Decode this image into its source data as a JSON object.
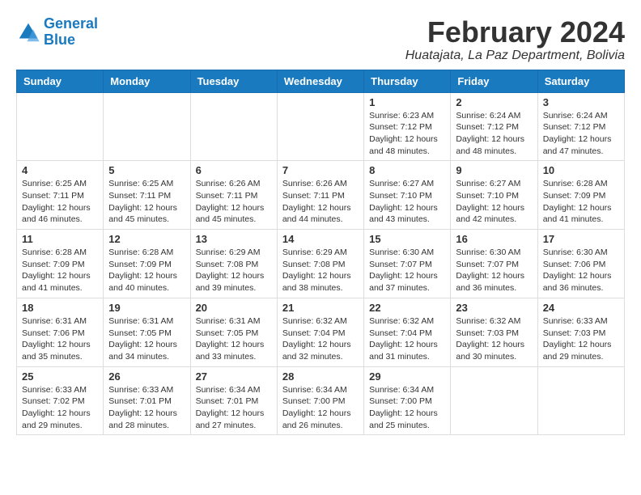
{
  "logo": {
    "line1": "General",
    "line2": "Blue"
  },
  "title": {
    "month_year": "February 2024",
    "location": "Huatajata, La Paz Department, Bolivia"
  },
  "weekdays": [
    "Sunday",
    "Monday",
    "Tuesday",
    "Wednesday",
    "Thursday",
    "Friday",
    "Saturday"
  ],
  "weeks": [
    [
      {
        "day": "",
        "sunrise": "",
        "sunset": "",
        "daylight": ""
      },
      {
        "day": "",
        "sunrise": "",
        "sunset": "",
        "daylight": ""
      },
      {
        "day": "",
        "sunrise": "",
        "sunset": "",
        "daylight": ""
      },
      {
        "day": "",
        "sunrise": "",
        "sunset": "",
        "daylight": ""
      },
      {
        "day": "1",
        "sunrise": "Sunrise: 6:23 AM",
        "sunset": "Sunset: 7:12 PM",
        "daylight": "Daylight: 12 hours and 48 minutes."
      },
      {
        "day": "2",
        "sunrise": "Sunrise: 6:24 AM",
        "sunset": "Sunset: 7:12 PM",
        "daylight": "Daylight: 12 hours and 48 minutes."
      },
      {
        "day": "3",
        "sunrise": "Sunrise: 6:24 AM",
        "sunset": "Sunset: 7:12 PM",
        "daylight": "Daylight: 12 hours and 47 minutes."
      }
    ],
    [
      {
        "day": "4",
        "sunrise": "Sunrise: 6:25 AM",
        "sunset": "Sunset: 7:11 PM",
        "daylight": "Daylight: 12 hours and 46 minutes."
      },
      {
        "day": "5",
        "sunrise": "Sunrise: 6:25 AM",
        "sunset": "Sunset: 7:11 PM",
        "daylight": "Daylight: 12 hours and 45 minutes."
      },
      {
        "day": "6",
        "sunrise": "Sunrise: 6:26 AM",
        "sunset": "Sunset: 7:11 PM",
        "daylight": "Daylight: 12 hours and 45 minutes."
      },
      {
        "day": "7",
        "sunrise": "Sunrise: 6:26 AM",
        "sunset": "Sunset: 7:11 PM",
        "daylight": "Daylight: 12 hours and 44 minutes."
      },
      {
        "day": "8",
        "sunrise": "Sunrise: 6:27 AM",
        "sunset": "Sunset: 7:10 PM",
        "daylight": "Daylight: 12 hours and 43 minutes."
      },
      {
        "day": "9",
        "sunrise": "Sunrise: 6:27 AM",
        "sunset": "Sunset: 7:10 PM",
        "daylight": "Daylight: 12 hours and 42 minutes."
      },
      {
        "day": "10",
        "sunrise": "Sunrise: 6:28 AM",
        "sunset": "Sunset: 7:09 PM",
        "daylight": "Daylight: 12 hours and 41 minutes."
      }
    ],
    [
      {
        "day": "11",
        "sunrise": "Sunrise: 6:28 AM",
        "sunset": "Sunset: 7:09 PM",
        "daylight": "Daylight: 12 hours and 41 minutes."
      },
      {
        "day": "12",
        "sunrise": "Sunrise: 6:28 AM",
        "sunset": "Sunset: 7:09 PM",
        "daylight": "Daylight: 12 hours and 40 minutes."
      },
      {
        "day": "13",
        "sunrise": "Sunrise: 6:29 AM",
        "sunset": "Sunset: 7:08 PM",
        "daylight": "Daylight: 12 hours and 39 minutes."
      },
      {
        "day": "14",
        "sunrise": "Sunrise: 6:29 AM",
        "sunset": "Sunset: 7:08 PM",
        "daylight": "Daylight: 12 hours and 38 minutes."
      },
      {
        "day": "15",
        "sunrise": "Sunrise: 6:30 AM",
        "sunset": "Sunset: 7:07 PM",
        "daylight": "Daylight: 12 hours and 37 minutes."
      },
      {
        "day": "16",
        "sunrise": "Sunrise: 6:30 AM",
        "sunset": "Sunset: 7:07 PM",
        "daylight": "Daylight: 12 hours and 36 minutes."
      },
      {
        "day": "17",
        "sunrise": "Sunrise: 6:30 AM",
        "sunset": "Sunset: 7:06 PM",
        "daylight": "Daylight: 12 hours and 36 minutes."
      }
    ],
    [
      {
        "day": "18",
        "sunrise": "Sunrise: 6:31 AM",
        "sunset": "Sunset: 7:06 PM",
        "daylight": "Daylight: 12 hours and 35 minutes."
      },
      {
        "day": "19",
        "sunrise": "Sunrise: 6:31 AM",
        "sunset": "Sunset: 7:05 PM",
        "daylight": "Daylight: 12 hours and 34 minutes."
      },
      {
        "day": "20",
        "sunrise": "Sunrise: 6:31 AM",
        "sunset": "Sunset: 7:05 PM",
        "daylight": "Daylight: 12 hours and 33 minutes."
      },
      {
        "day": "21",
        "sunrise": "Sunrise: 6:32 AM",
        "sunset": "Sunset: 7:04 PM",
        "daylight": "Daylight: 12 hours and 32 minutes."
      },
      {
        "day": "22",
        "sunrise": "Sunrise: 6:32 AM",
        "sunset": "Sunset: 7:04 PM",
        "daylight": "Daylight: 12 hours and 31 minutes."
      },
      {
        "day": "23",
        "sunrise": "Sunrise: 6:32 AM",
        "sunset": "Sunset: 7:03 PM",
        "daylight": "Daylight: 12 hours and 30 minutes."
      },
      {
        "day": "24",
        "sunrise": "Sunrise: 6:33 AM",
        "sunset": "Sunset: 7:03 PM",
        "daylight": "Daylight: 12 hours and 29 minutes."
      }
    ],
    [
      {
        "day": "25",
        "sunrise": "Sunrise: 6:33 AM",
        "sunset": "Sunset: 7:02 PM",
        "daylight": "Daylight: 12 hours and 29 minutes."
      },
      {
        "day": "26",
        "sunrise": "Sunrise: 6:33 AM",
        "sunset": "Sunset: 7:01 PM",
        "daylight": "Daylight: 12 hours and 28 minutes."
      },
      {
        "day": "27",
        "sunrise": "Sunrise: 6:34 AM",
        "sunset": "Sunset: 7:01 PM",
        "daylight": "Daylight: 12 hours and 27 minutes."
      },
      {
        "day": "28",
        "sunrise": "Sunrise: 6:34 AM",
        "sunset": "Sunset: 7:00 PM",
        "daylight": "Daylight: 12 hours and 26 minutes."
      },
      {
        "day": "29",
        "sunrise": "Sunrise: 6:34 AM",
        "sunset": "Sunset: 7:00 PM",
        "daylight": "Daylight: 12 hours and 25 minutes."
      },
      {
        "day": "",
        "sunrise": "",
        "sunset": "",
        "daylight": ""
      },
      {
        "day": "",
        "sunrise": "",
        "sunset": "",
        "daylight": ""
      }
    ]
  ]
}
